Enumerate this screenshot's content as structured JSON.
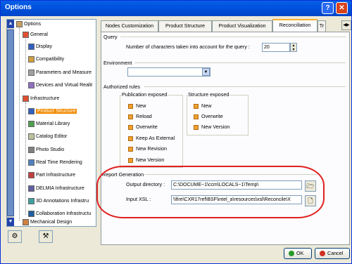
{
  "window": {
    "title": "Options"
  },
  "titlebar": {
    "help_label": "?",
    "close_label": "✕"
  },
  "tree": {
    "items": [
      {
        "label": "Options"
      },
      {
        "label": "General"
      },
      {
        "label": "Display"
      },
      {
        "label": "Compatibility"
      },
      {
        "label": "Parameters and Measure"
      },
      {
        "label": "Devices and Virtual Realit"
      },
      {
        "label": "Infrastructure"
      },
      {
        "label": "Product Structure"
      },
      {
        "label": "Material Library"
      },
      {
        "label": "Catalog Editor"
      },
      {
        "label": "Photo Studio"
      },
      {
        "label": "Real Time Rendering"
      },
      {
        "label": "Part Infrastructure"
      },
      {
        "label": "DELMIA Infrastructure"
      },
      {
        "label": "3D Annotations Infrastru"
      },
      {
        "label": "Collaboration Infrastructu"
      },
      {
        "label": "Mechanical Design"
      }
    ],
    "selected": "Product Structure"
  },
  "tabs": [
    {
      "label": "Nodes Customization"
    },
    {
      "label": "Product Structure"
    },
    {
      "label": "Product Visualization"
    },
    {
      "label": "Reconciliation"
    },
    {
      "label": "Tr"
    }
  ],
  "active_tab": "Reconciliation",
  "query": {
    "group_label": "Query",
    "chars_label": "Number of characters taken into account for the query :",
    "chars_value": "20"
  },
  "environment": {
    "group_label": "Environment",
    "value": ""
  },
  "authorized_rules": {
    "group_label": "Authorized rules",
    "publication_label": "Publication exposed",
    "publication_items": [
      "New",
      "Reload",
      "Overwrite",
      "Keep As External",
      "New Revision",
      "New Version"
    ],
    "structure_label": "Structure exposed",
    "structure_items": [
      "New",
      "Overwrite",
      "New Version"
    ]
  },
  "report": {
    "group_label": "Report Generation",
    "output_label": "Output directory :",
    "output_value": "C:\\DOCUME~1\\ccm\\LOCALS~1\\Temp\\",
    "xsl_label": "Input XSL :",
    "xsl_value": "\\\\fire\\CXR17ref\\BSF\\intel_a\\resources\\xsl\\Reconcile\\X"
  },
  "buttons": {
    "ok": "OK",
    "cancel": "Cancel"
  },
  "colors": {
    "accent": "#0053e0",
    "selection": "#f08a00",
    "highlight_oval": "#e02020"
  }
}
